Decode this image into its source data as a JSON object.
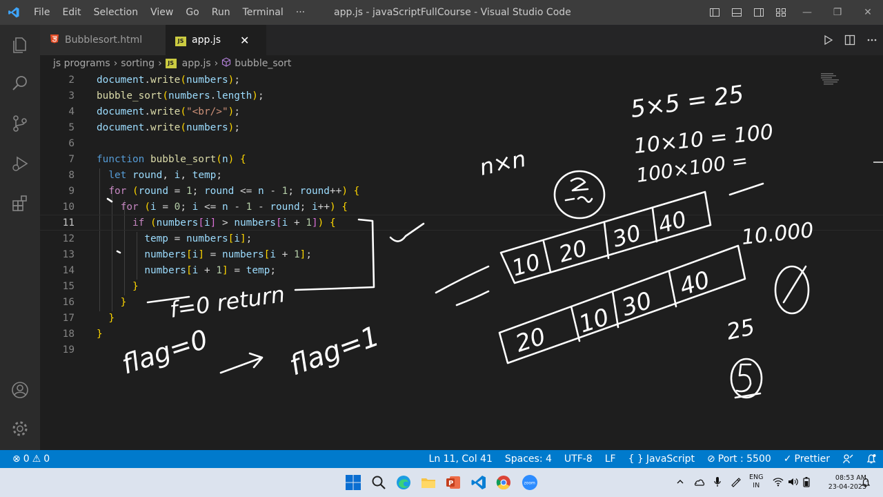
{
  "titlebar": {
    "menu": [
      "File",
      "Edit",
      "Selection",
      "View",
      "Go",
      "Run",
      "Terminal",
      "···"
    ],
    "window_title": "app.js - javaScriptFullCourse - Visual Studio Code",
    "min": "—",
    "max": "❐",
    "close": "✕"
  },
  "tabs": [
    {
      "label": "Bubblesort.html",
      "icon": "html-file-icon",
      "active": false
    },
    {
      "label": "app.js",
      "icon": "js-file-icon",
      "active": true
    }
  ],
  "tab_close": "✕",
  "breadcrumb": {
    "items": [
      "js programs",
      "sorting",
      "app.js",
      "bubble_sort"
    ],
    "js_badge": "JS"
  },
  "editor": {
    "line_numbers": [
      "2",
      "3",
      "4",
      "5",
      "6",
      "7",
      "8",
      "9",
      "10",
      "11",
      "12",
      "13",
      "14",
      "15",
      "16",
      "17",
      "18",
      "19"
    ],
    "current_line": "11",
    "code_lines": [
      "document.write(numbers);",
      "bubble_sort(numbers.length);",
      "document.write(\"<br/>\");",
      "document.write(numbers);",
      "",
      "function bubble_sort(n) {",
      "  let round, i, temp;",
      "  for (round = 1; round <= n - 1; round++) {",
      "    for (i = 0; i <= n - 1 - round; i++) {",
      "      if (numbers[i] > numbers[i + 1]) {",
      "        temp = numbers[i];",
      "        numbers[i] = numbers[i + 1];",
      "        numbers[i + 1] = temp;",
      "      }",
      "    }",
      "  }",
      "}",
      ""
    ]
  },
  "handwriting": {
    "flag_zero": "flag=0",
    "flag_one": "flag=1",
    "f_zero_return": "f=0 return",
    "n_times_n": "n×n",
    "five_times_five": "5×5 = 25",
    "ten_times_ten": "10×10 = 100",
    "hundred_times_hundred": "100×100 =",
    "ten_thousand": "10.000",
    "twenty_five": "25",
    "five": "5",
    "array_top": [
      "10",
      "20",
      "30",
      "40"
    ],
    "array_bottom": [
      "20",
      "10",
      "30",
      "40"
    ]
  },
  "statusbar": {
    "errors": "0",
    "warnings": "0",
    "position": "Ln 11, Col 41",
    "spaces": "Spaces: 4",
    "encoding": "UTF-8",
    "eol": "LF",
    "language": "JavaScript",
    "language_prefix": "{ }",
    "port": "Port : 5500",
    "prettier": "Prettier"
  },
  "taskbar": {
    "lang_top": "ENG",
    "lang_bottom": "IN",
    "time": "08:53 AM",
    "date": "23-04-2023",
    "zoom_label": "zoom"
  },
  "colors": {
    "accent": "#007acc",
    "keyword": "#569cd6",
    "control": "#c586c0",
    "function": "#dcdcaa",
    "variable": "#9cdcfe",
    "string": "#ce9178",
    "number": "#b5cea8",
    "bracket_gold": "#ffd700",
    "bracket_purple": "#da70d6",
    "bracket_blue": "#179fff"
  }
}
